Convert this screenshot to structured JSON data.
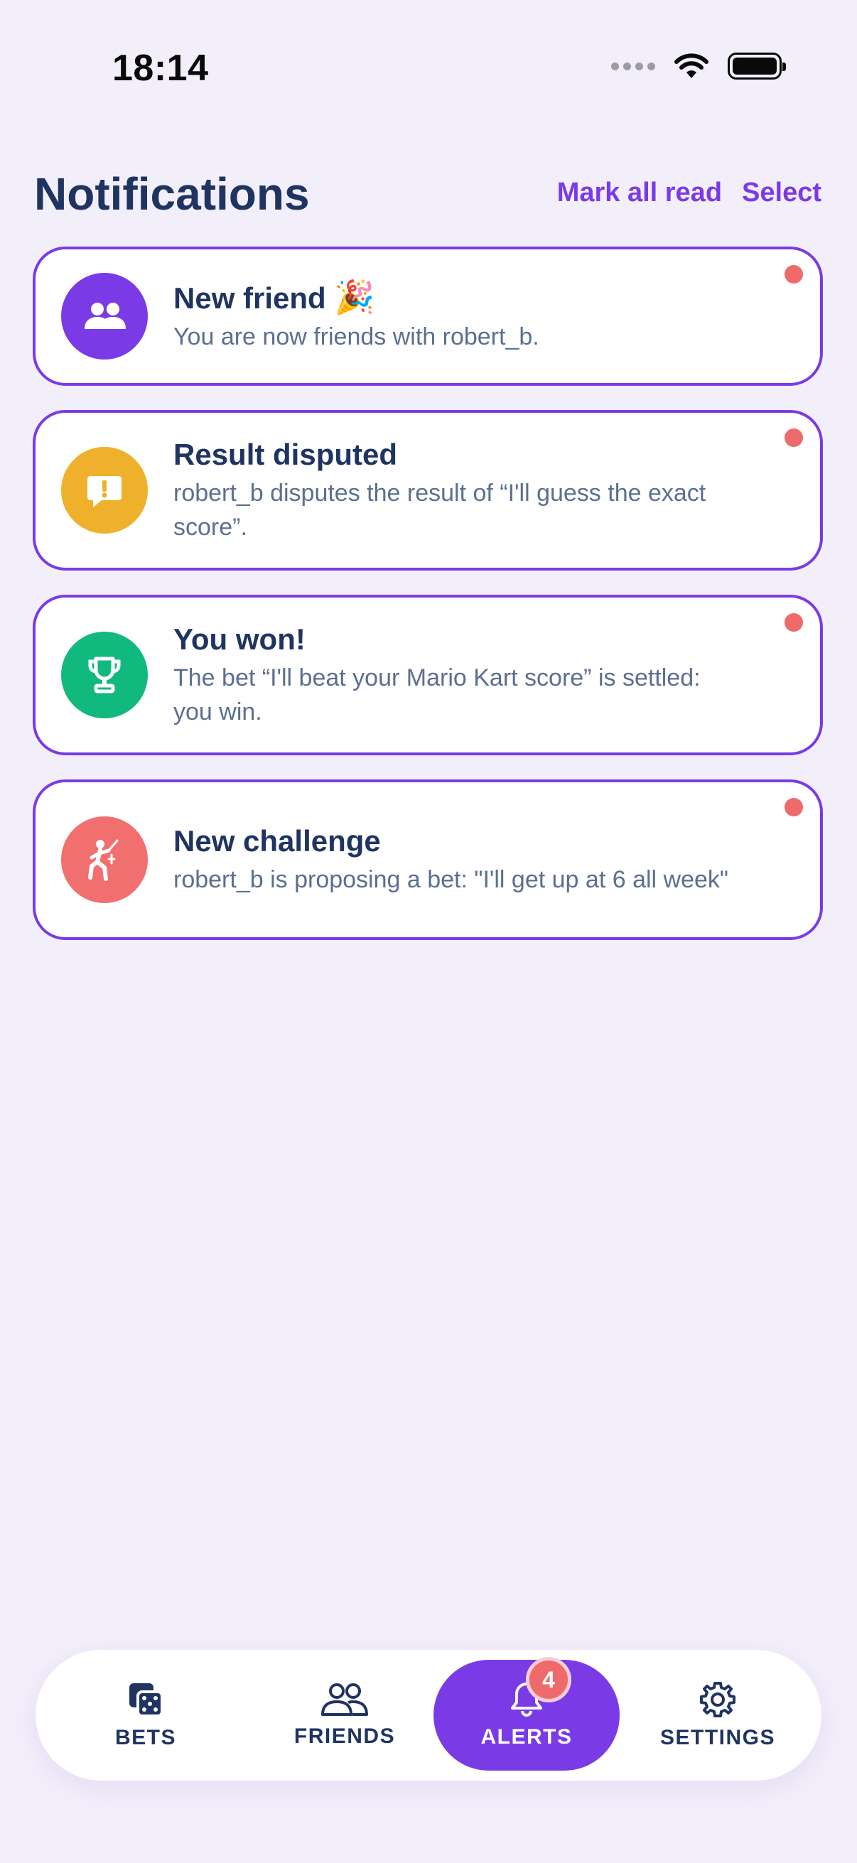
{
  "status_bar": {
    "time": "18:14"
  },
  "header": {
    "title": "Notifications",
    "mark_all_read": "Mark all read",
    "select": "Select"
  },
  "notifications": [
    {
      "title": "New friend",
      "emoji": "🎉",
      "body": "You are now friends with robert_b.",
      "icon": "people-icon",
      "color": "#7a3be6",
      "unread": true
    },
    {
      "title": "Result disputed",
      "body": "robert_b disputes the result of “I'll guess the exact score”.",
      "icon": "exclamation-bubble-icon",
      "color": "#efb12b",
      "unread": true
    },
    {
      "title": "You won!",
      "body": "The bet “I'll beat your Mario Kart score” is settled: you win.",
      "icon": "trophy-icon",
      "color": "#12b97e",
      "unread": true
    },
    {
      "title": "New challenge",
      "body": "robert_b is proposing a bet: \"I'll get up at 6 all week\"",
      "icon": "fencing-icon",
      "color": "#f26f6f",
      "unread": true
    }
  ],
  "tabbar": {
    "bets": "BETS",
    "friends": "FRIENDS",
    "alerts": "ALERTS",
    "alerts_badge": "4",
    "settings": "SETTINGS",
    "active": "alerts"
  },
  "colors": {
    "accent": "#7a3be6",
    "unread_dot": "#ef6b6b",
    "background": "#f3effa"
  }
}
